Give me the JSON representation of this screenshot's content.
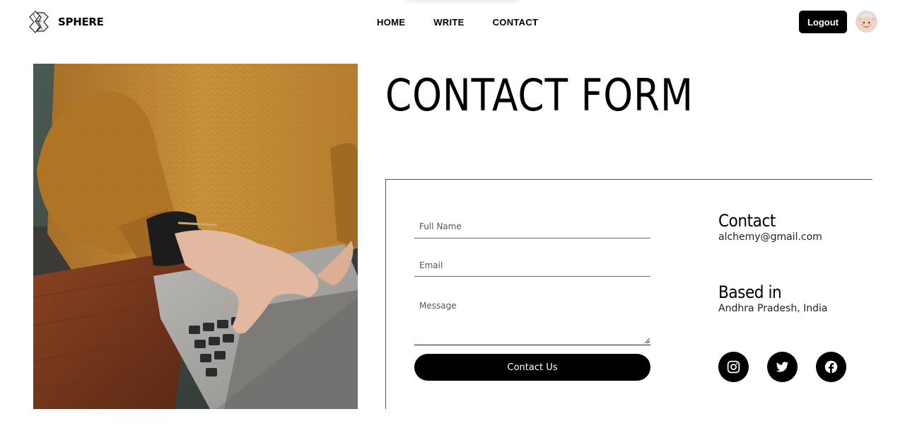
{
  "header": {
    "brand_name": "SPHERE",
    "nav": [
      {
        "label": "HOME"
      },
      {
        "label": "WRITE"
      },
      {
        "label": "CONTACT"
      }
    ],
    "logout_label": "Logout"
  },
  "main": {
    "title": "CONTACT FORM",
    "form": {
      "full_name_placeholder": "Full Name",
      "email_placeholder": "Email",
      "message_placeholder": "Message",
      "submit_label": "Contact Us"
    },
    "contact_info": {
      "contact_heading": "Contact",
      "email": "alchemy@gmail.com",
      "based_heading": "Based in",
      "location": "Andhra Pradesh, India"
    },
    "socials": [
      {
        "icon": "instagram-icon"
      },
      {
        "icon": "twitter-icon"
      },
      {
        "icon": "facebook-icon"
      }
    ]
  },
  "colors": {
    "primary": "#000000",
    "background": "#ffffff",
    "sweater": "#c58a34",
    "desk": "#7a3a1c"
  }
}
